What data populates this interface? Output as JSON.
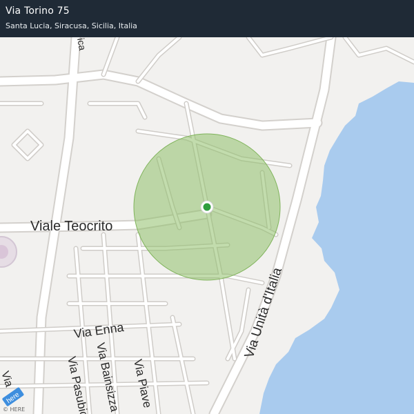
{
  "header": {
    "title": "Via Torino 75",
    "subtitle": "Santa Lucia, Siracusa, Sicilia, Italia"
  },
  "map": {
    "street_labels": [
      {
        "text": "Viale  Teocrito"
      },
      {
        "text": "Via Unità d'Italia"
      },
      {
        "text": "Via  Enna"
      },
      {
        "text": "Via  Bainsizza"
      },
      {
        "text": "Via  Pasubio"
      },
      {
        "text": "Via  Piave"
      },
      {
        "text": "Via"
      },
      {
        "text": "ica"
      }
    ],
    "location_marker": {
      "label": "location-dot"
    },
    "accuracy_circle": {
      "color": "#8fbf6a"
    },
    "water_color": "#a9cbee",
    "land_color": "#f2f1ef",
    "road_color": "#ffffff",
    "road_outline_color": "#d3d0cc"
  },
  "attribution": {
    "logo_text": "here",
    "copyright": "© HERE"
  }
}
